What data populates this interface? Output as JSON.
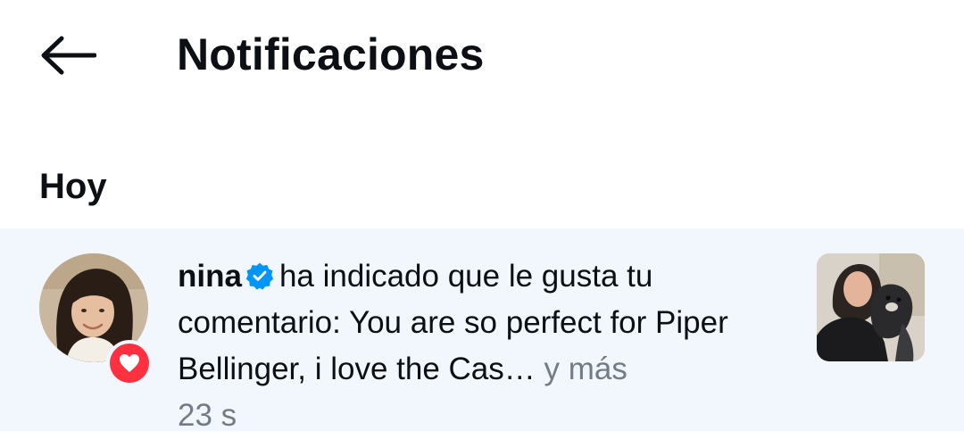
{
  "header": {
    "back_icon": "arrow-left-icon",
    "title": "Notificaciones"
  },
  "sections": [
    {
      "heading": "Hoy",
      "notifications": [
        {
          "username": "nina",
          "verified": true,
          "text": "ha indicado que le gusta tu comentario: You are so perfect for Piper Bellinger, i love the Cas…",
          "more_label": "y más",
          "time": "23 s",
          "badge_icon": "heart-icon",
          "colors": {
            "row_background": "#f2f7fd",
            "badge": "#ff3040",
            "verified": "#0095f6",
            "secondary_text": "#737b86"
          }
        }
      ]
    }
  ]
}
